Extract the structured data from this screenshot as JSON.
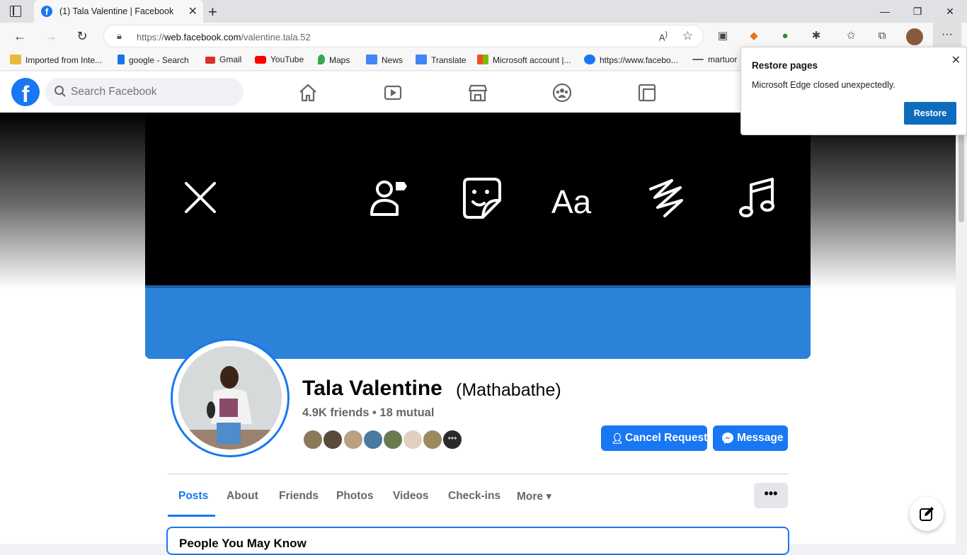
{
  "browser": {
    "tab_title": "(1) Tala Valentine | Facebook",
    "url_prefix": "https://",
    "url_domain": "web.facebook.com",
    "url_path": "/valentine.tala.52"
  },
  "bookmarks": [
    {
      "label": "Imported from Inte...",
      "icon": "folder-icon",
      "color": "#e8b93b"
    },
    {
      "label": "google - Search",
      "icon": "bing-icon",
      "color": "#1a73e8"
    },
    {
      "label": "Gmail",
      "icon": "gmail-icon",
      "color": "#d93025"
    },
    {
      "label": "YouTube",
      "icon": "youtube-icon",
      "color": "#ff0000"
    },
    {
      "label": "Maps",
      "icon": "maps-icon",
      "color": "#34a853"
    },
    {
      "label": "News",
      "icon": "news-icon",
      "color": "#4285f4"
    },
    {
      "label": "Translate",
      "icon": "translate-icon",
      "color": "#4285f4"
    },
    {
      "label": "Microsoft account |...",
      "icon": "microsoft-icon",
      "color": "#f25022"
    },
    {
      "label": "https://www.facebo...",
      "icon": "facebook-icon",
      "color": "#1877f2"
    },
    {
      "label": "martuor",
      "icon": "link-icon",
      "color": "#666666"
    }
  ],
  "facebook": {
    "logo": "f",
    "search_placeholder": "Search Facebook"
  },
  "profile": {
    "name": "Tala Valentine",
    "alt_name": "(Mathabathe)",
    "friends_line": "4.9K friends • 18 mutual",
    "cancel_request_label": "Cancel Request",
    "message_label": "Message",
    "more_dots": "•••"
  },
  "profile_tabs": [
    {
      "label": "Posts",
      "active": true
    },
    {
      "label": "About"
    },
    {
      "label": "Friends"
    },
    {
      "label": "Photos"
    },
    {
      "label": "Videos"
    },
    {
      "label": "Check-ins"
    },
    {
      "label": "More ▾"
    }
  ],
  "people_you_may_know": "People You May Know",
  "restore_popup": {
    "title": "Restore pages",
    "message": "Microsoft Edge closed unexpectedly.",
    "button": "Restore"
  },
  "colors": {
    "fb_blue": "#1877f2",
    "edge_blue": "#0f6cbd"
  }
}
